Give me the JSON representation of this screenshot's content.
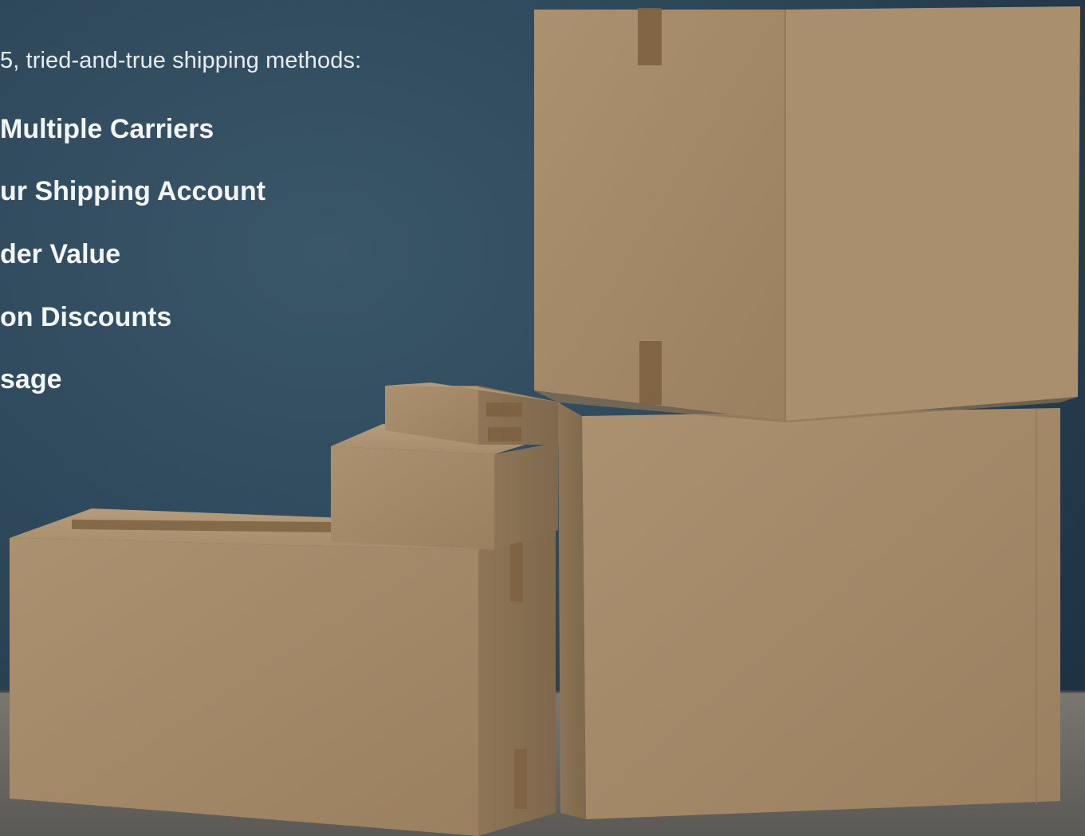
{
  "hero": {
    "intro_text": "5, tried-and-true shipping methods:",
    "methods": [
      {
        "label": "Multiple Carriers"
      },
      {
        "label": "ur Shipping Account"
      },
      {
        "label": "der Value"
      },
      {
        "label": "on Discounts"
      },
      {
        "label": "sage"
      }
    ]
  },
  "colors": {
    "wall": "#2c4658",
    "cardboard": "#a48a6a",
    "tape": "#7d6040",
    "text": "#f3f6f8"
  }
}
